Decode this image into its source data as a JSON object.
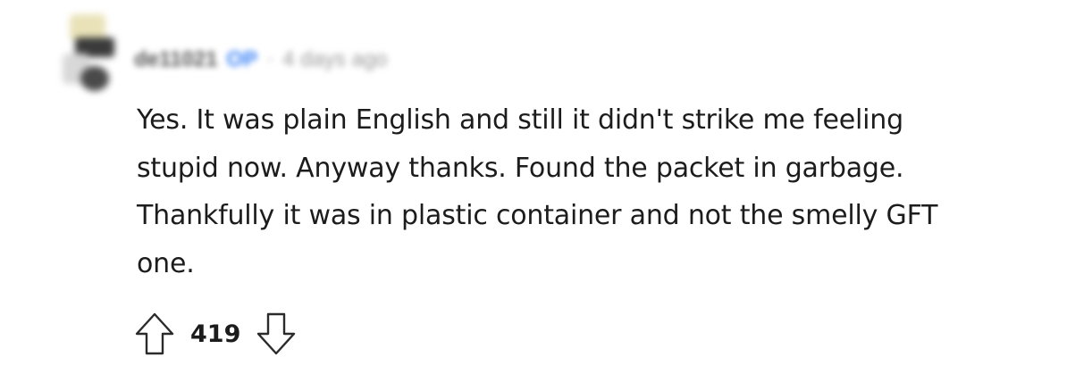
{
  "comment": {
    "author": {
      "username": "de11021",
      "op_badge": "OP",
      "separator": "·",
      "time": "4 days ago"
    },
    "body_lines": [
      "Yes. It was plain English and still it didn't strike me feeling",
      "stupid now. Anyway thanks. Found the packet in garbage.",
      "Thankfully it was in plastic container and not the smelly GFT",
      "one."
    ],
    "votes": {
      "score": "419",
      "upvote_icon": "arrow-up-outline-icon",
      "downvote_icon": "arrow-down-outline-icon"
    }
  }
}
